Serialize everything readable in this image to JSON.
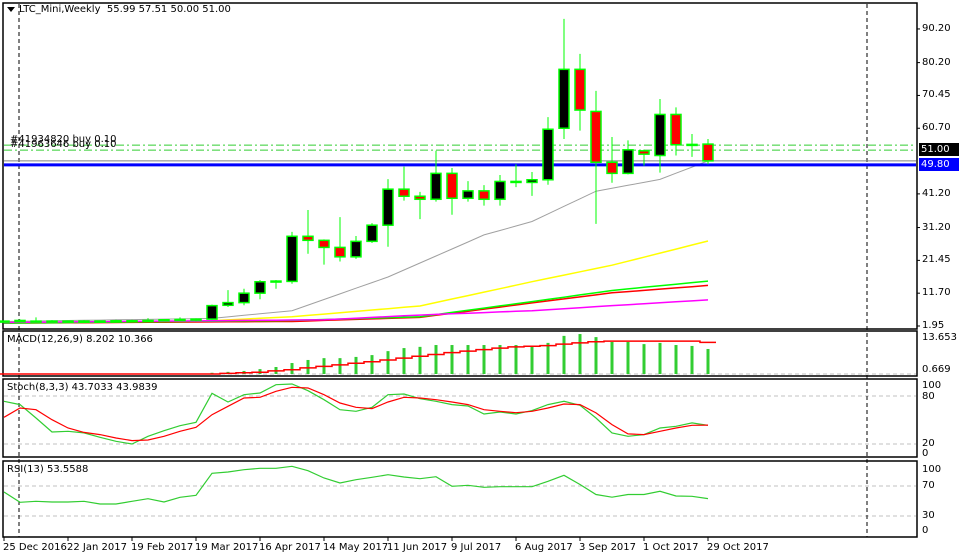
{
  "header": {
    "symbol": "LTC_Mini,Weekly",
    "ohlc": "55.99 57.51 50.00 51.00"
  },
  "colors": {
    "bull_body": "#000000",
    "bear_body": "#ff0000",
    "candle_outline": "#00ff00",
    "price_line": "#0000ff",
    "order_line": "#32cd32",
    "macd_hist": "#32cd32",
    "signal": "#ff0000",
    "stoch_main": "#32cd32",
    "stoch_signal": "#ff0000",
    "rsi": "#32cd32"
  },
  "orders": [
    {
      "label": "#41934820 buy 0.10",
      "price": 55.7
    },
    {
      "label": "#41963646 buy 0.10",
      "price": 54.2
    }
  ],
  "price_axis": {
    "ticks": [
      "90.20",
      "80.20",
      "70.45",
      "60.70",
      "41.20",
      "31.20",
      "21.45",
      "11.70",
      "1.95"
    ],
    "current_price": "51.00",
    "line_price_label": "49.80"
  },
  "time_axis": [
    "25 Dec 2016",
    "22 Jan 2017",
    "19 Feb 2017",
    "19 Mar 2017",
    "16 Apr 2017",
    "14 May 2017",
    "11 Jun 2017",
    "9 Jul 2017",
    "6 Aug 2017",
    "3 Sep 2017",
    "1 Oct 2017",
    "29 Oct 2017"
  ],
  "indicators": {
    "macd": {
      "label": "MACD(12,26,9) 8.202 10.366",
      "axis": [
        "13.653",
        "0.669"
      ]
    },
    "stoch": {
      "label": "Stoch(8,3,3) 43.7033 43.9839",
      "axis": [
        "100",
        "80",
        "20",
        "0"
      ]
    },
    "rsi": {
      "label": "RSI(13) 53.5588",
      "axis": [
        "100",
        "70",
        "30",
        "0"
      ]
    }
  },
  "chart_data": {
    "type": "candlestick",
    "title": "LTC_Mini,Weekly",
    "ylim": [
      1.95,
      90.2
    ],
    "candles_ohlc": [
      [
        3.4,
        3.6,
        3.0,
        3.3
      ],
      [
        3.6,
        3.9,
        3.1,
        3.2
      ],
      [
        3.2,
        4.5,
        3.0,
        3.4
      ],
      [
        3.4,
        3.7,
        3.0,
        3.2
      ],
      [
        3.2,
        3.6,
        3.0,
        3.4
      ],
      [
        3.4,
        3.7,
        3.1,
        3.3
      ],
      [
        3.3,
        3.6,
        3.0,
        3.4
      ],
      [
        3.4,
        3.8,
        3.1,
        3.5
      ],
      [
        3.5,
        3.8,
        3.2,
        3.4
      ],
      [
        3.4,
        4.3,
        3.2,
        3.6
      ],
      [
        3.6,
        4.0,
        3.3,
        3.8
      ],
      [
        3.8,
        4.5,
        3.5,
        3.9
      ],
      [
        3.9,
        4.2,
        3.4,
        4.0
      ],
      [
        4.0,
        8.3,
        3.8,
        8.0
      ],
      [
        8.1,
        12.6,
        7.6,
        8.9
      ],
      [
        8.9,
        13.0,
        8.1,
        11.7
      ],
      [
        11.7,
        15.6,
        9.9,
        15.1
      ],
      [
        15.2,
        15.6,
        13.0,
        15.3
      ],
      [
        15.2,
        29.9,
        14.5,
        28.6
      ],
      [
        28.6,
        36.4,
        23.4,
        27.4
      ],
      [
        27.4,
        27.7,
        20.2,
        25.3
      ],
      [
        25.3,
        34.3,
        21.1,
        22.5
      ],
      [
        22.5,
        28.7,
        21.9,
        27.1
      ],
      [
        27.1,
        32.5,
        26.6,
        31.9
      ],
      [
        31.9,
        45.6,
        25.5,
        42.6
      ],
      [
        42.6,
        49.3,
        39.2,
        40.5
      ],
      [
        40.5,
        41.8,
        33.7,
        39.6
      ],
      [
        39.6,
        54.0,
        38.9,
        47.3
      ],
      [
        47.3,
        48.9,
        35.0,
        39.9
      ],
      [
        39.9,
        45.0,
        38.9,
        42.1
      ],
      [
        42.1,
        43.8,
        37.7,
        39.6
      ],
      [
        39.6,
        46.8,
        37.7,
        44.9
      ],
      [
        44.9,
        50.0,
        43.2,
        44.8
      ],
      [
        44.6,
        47.7,
        40.6,
        45.4
      ],
      [
        45.4,
        64.0,
        43.9,
        60.4
      ],
      [
        60.7,
        93.2,
        57.5,
        78.2
      ],
      [
        78.2,
        82.8,
        60.0,
        66.1
      ],
      [
        65.7,
        71.8,
        32.3,
        50.6
      ],
      [
        50.6,
        58.1,
        44.5,
        47.3
      ],
      [
        47.3,
        57.1,
        47.0,
        54.3
      ],
      [
        54.0,
        54.4,
        49.6,
        53.0
      ],
      [
        52.6,
        69.4,
        47.5,
        64.8
      ],
      [
        64.8,
        66.9,
        52.6,
        55.8
      ],
      [
        55.8,
        59.0,
        52.2,
        55.9
      ],
      [
        55.99,
        57.51,
        50.0,
        51.0
      ]
    ],
    "moving_averages": [
      {
        "name": "ma-gray",
        "color": "#a0a0a0",
        "anchors": [
          [
            0,
            3.3
          ],
          [
            13,
            4.2
          ],
          [
            18,
            6.5
          ],
          [
            24,
            16.5
          ],
          [
            30,
            29
          ],
          [
            33,
            33
          ],
          [
            37,
            42
          ],
          [
            41,
            45.5
          ],
          [
            44,
            51
          ]
        ]
      },
      {
        "name": "ma-yellow",
        "color": "#ffff00",
        "anchors": [
          [
            0,
            3
          ],
          [
            12,
            3.3
          ],
          [
            18,
            4.7
          ],
          [
            26,
            7.9
          ],
          [
            33,
            15.1
          ],
          [
            38,
            20
          ],
          [
            44,
            27.2
          ]
        ]
      },
      {
        "name": "ma-red",
        "color": "#ff0000",
        "anchors": [
          [
            0,
            2.8
          ],
          [
            18,
            3.3
          ],
          [
            26,
            4.5
          ],
          [
            33,
            8.8
          ],
          [
            38,
            11.8
          ],
          [
            44,
            14
          ]
        ]
      },
      {
        "name": "ma-green",
        "color": "#00ff00",
        "anchors": [
          [
            0,
            2.8
          ],
          [
            18,
            3.6
          ],
          [
            26,
            4.7
          ],
          [
            33,
            9.2
          ],
          [
            38,
            12.5
          ],
          [
            44,
            15.3
          ]
        ]
      },
      {
        "name": "ma-magenta",
        "color": "#ff00ff",
        "anchors": [
          [
            0,
            3
          ],
          [
            20,
            3.8
          ],
          [
            26,
            5.2
          ],
          [
            33,
            6.5
          ],
          [
            38,
            8
          ],
          [
            44,
            9.7
          ]
        ]
      }
    ],
    "horizontal_lines": {
      "price_line": 49.8,
      "bid": 51.0
    },
    "macd_histogram": [
      0,
      0,
      0,
      0,
      0,
      0,
      0,
      0,
      0,
      0,
      0,
      0,
      0,
      0.4,
      0.7,
      1.0,
      1.6,
      2.3,
      3.6,
      4.6,
      5.2,
      5.2,
      5.6,
      6.2,
      7.5,
      8.5,
      8.9,
      9.5,
      9.5,
      9.5,
      9.5,
      9.5,
      9.5,
      8.9,
      10.2,
      12.5,
      13.1,
      12.1,
      10.5,
      10.5,
      9.8,
      10.2,
      9.5,
      9.2,
      8.202
    ],
    "macd_signal": [
      0,
      0,
      0,
      0,
      0,
      0,
      0,
      0,
      0,
      0,
      0,
      0,
      0,
      0,
      0.2,
      0.4,
      0.6,
      1.0,
      1.4,
      2.0,
      2.5,
      3.0,
      3.5,
      4.0,
      4.6,
      5.2,
      5.8,
      6.4,
      7.0,
      7.5,
      8.0,
      8.5,
      8.9,
      9.1,
      9.3,
      9.8,
      10.2,
      10.6,
      10.8,
      10.8,
      10.8,
      10.8,
      10.8,
      10.8,
      10.366
    ],
    "stoch_k": [
      73.7,
      69.6,
      52.9,
      35.4,
      36.2,
      34.2,
      28.8,
      23.7,
      20.4,
      30,
      37,
      43.3,
      47.5,
      83.7,
      72.9,
      82,
      84.1,
      94.5,
      95.4,
      87,
      75.8,
      63.3,
      61.2,
      66.2,
      82,
      82.9,
      77,
      73.7,
      69.6,
      67.9,
      57.9,
      60.4,
      57.9,
      62.1,
      69.6,
      73.7,
      68.7,
      52.9,
      34.2,
      30,
      32.1,
      40.4,
      42.5,
      46.7,
      43.7
    ],
    "stoch_d": [
      53.7,
      65.4,
      63.3,
      50.8,
      40.4,
      34.9,
      32.1,
      27.9,
      24.6,
      25.4,
      30,
      36.2,
      41.2,
      57,
      67.5,
      77.9,
      78.7,
      86.2,
      91.2,
      90.4,
      82,
      71.6,
      66.2,
      64.6,
      72.9,
      78.7,
      77.9,
      75.8,
      72.9,
      69.6,
      63.3,
      61.2,
      59.5,
      61.2,
      65.4,
      70.4,
      69.6,
      59.2,
      44.6,
      33,
      32.1,
      36.2,
      40.4,
      43.7,
      43.98
    ],
    "rsi": [
      62.4,
      48.6,
      50,
      49.1,
      49.1,
      50,
      46.4,
      46.4,
      50,
      53.5,
      49.1,
      55.3,
      58,
      87.3,
      89.1,
      92.1,
      94,
      94,
      96.6,
      90.8,
      81,
      74.4,
      78.8,
      82,
      85.5,
      82.4,
      80.1,
      82.8,
      70,
      71.3,
      68.6,
      69.5,
      69.5,
      69.5,
      76.6,
      84.6,
      72.4,
      59.1,
      55.5,
      59.1,
      59.1,
      63.3,
      57.1,
      56.6,
      53.56
    ]
  }
}
